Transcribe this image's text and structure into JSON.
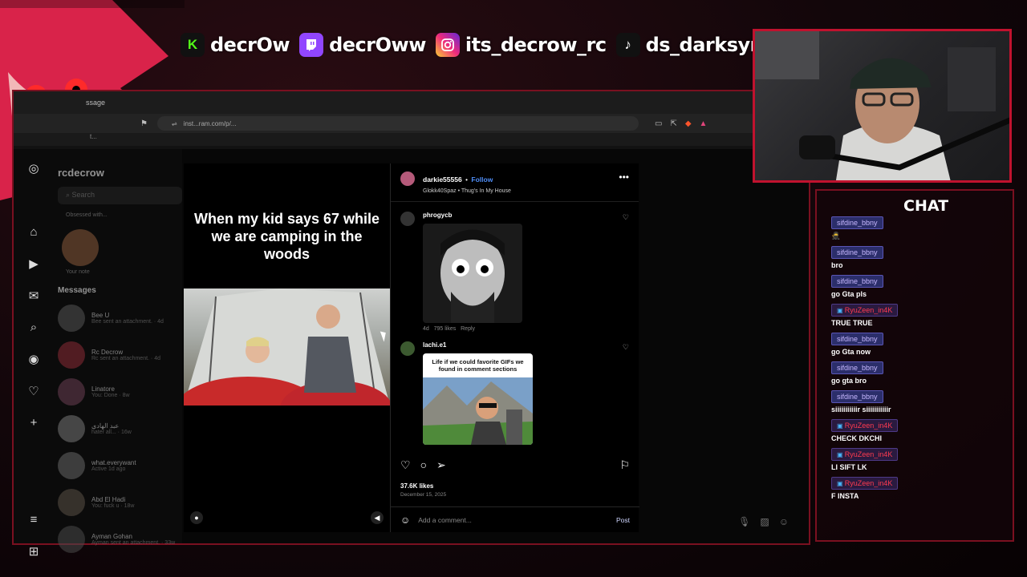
{
  "banner": {
    "kick": "decrOw",
    "twitch": "decrOww",
    "instagram": "its_decrow_rc",
    "tiktok": "ds_darksync"
  },
  "browser": {
    "tab_label": "ssage",
    "url": "inst...ram.com/p/...",
    "bookmark_label": "t..."
  },
  "instagram": {
    "username": "rcdecrow",
    "search_placeholder": "Search",
    "note_label": "Your note",
    "note_bubble": "Obsessed with...",
    "messages_heading": "Messages",
    "conversations": [
      {
        "name": "Bee U",
        "sub": "Bee sent an attachment. · 4d"
      },
      {
        "name": "Rc Decrow",
        "sub": "Rc sent an attachment. · 4d"
      },
      {
        "name": "Linatore",
        "sub": "You: Done · 8w"
      },
      {
        "name": "عبد الهادي",
        "sub": "hater all... · 16w"
      },
      {
        "name": "what.everywant",
        "sub": "Active 1d ago"
      },
      {
        "name": "Abd El Hadi",
        "sub": "You: fuck u · 18w"
      },
      {
        "name": "Ayman Gohan",
        "sub": "Ayman sent an attachment. · 33w"
      }
    ]
  },
  "post": {
    "caption": "When my kid says 67 while we are camping in the woods",
    "author": "darkie55556",
    "follow_label": "Follow",
    "audio": "Glokk40Spaz • Thug's In My House",
    "comments": [
      {
        "user": "phrogycb",
        "age": "4d",
        "likes": "795 likes",
        "reply": "Reply"
      },
      {
        "user": "lachi.e1",
        "gif_caption": "Life if we could favorite GIFs we found in comment sections"
      }
    ],
    "like_count": "37.6K likes",
    "date": "December 15, 2025",
    "comment_placeholder": "Add a comment...",
    "post_button": "Post"
  },
  "chat": {
    "title": "CHAT",
    "messages": [
      {
        "user": "sifdine_bbny",
        "text": "🥷",
        "style": "purple"
      },
      {
        "user": "sifdine_bbny",
        "text": "bro",
        "style": "purple"
      },
      {
        "user": "sifdine_bbny",
        "text": "go Gta pls",
        "style": "purple"
      },
      {
        "user": "RyuZeen_in4K",
        "text": "TRUE TRUE",
        "style": "red"
      },
      {
        "user": "sifdine_bbny",
        "text": "go Gta now",
        "style": "purple"
      },
      {
        "user": "sifdine_bbny",
        "text": "go gta bro",
        "style": "purple"
      },
      {
        "user": "sifdine_bbny",
        "text": "siiiiiiiiiiir siiiiiiiiiiir",
        "style": "purple"
      },
      {
        "user": "RyuZeen_in4K",
        "text": "CHECK DKCHI",
        "style": "red"
      },
      {
        "user": "RyuZeen_in4K",
        "text": "LI SIFT LK",
        "style": "red"
      },
      {
        "user": "RyuZeen_in4K",
        "text": "F INSTA",
        "style": "red"
      }
    ]
  },
  "colors": {
    "accent_red": "#c0122e",
    "insta_blue": "#4f8ef7",
    "chat_username_purple": "#c7b8ff",
    "chat_username_red": "#ff3b50"
  }
}
